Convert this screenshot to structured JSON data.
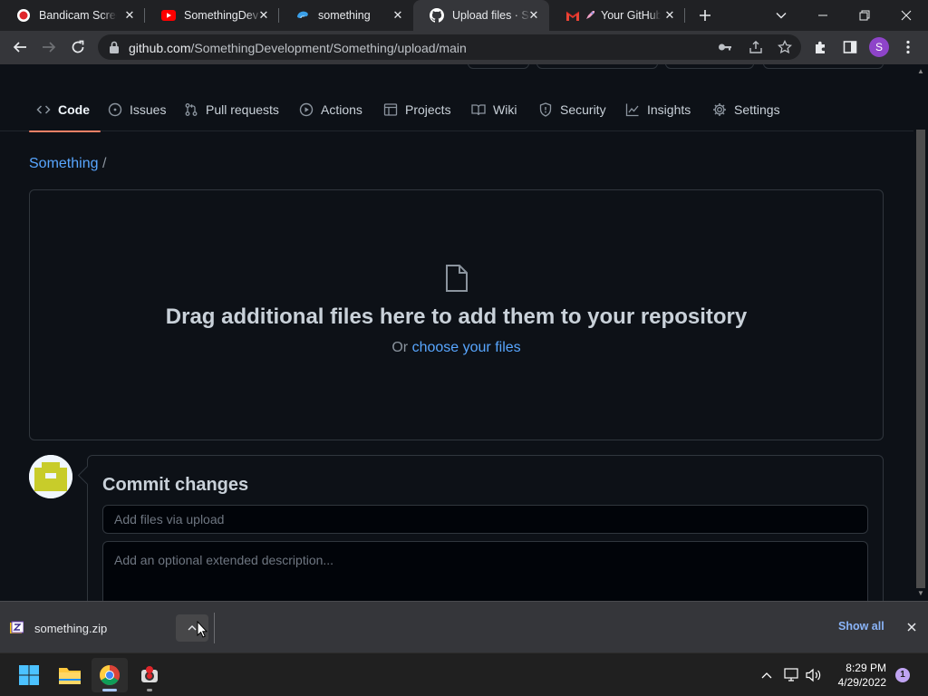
{
  "browser": {
    "tabs": [
      {
        "title": "Bandicam Screen Recorder",
        "icon": "bandicam-icon",
        "active": false
      },
      {
        "title": "SomethingDev",
        "icon": "youtube-icon",
        "active": false
      },
      {
        "title": "something",
        "icon": "edge-swirl-icon",
        "active": false
      },
      {
        "title": "Upload files · SomethingDevelopment/Something",
        "icon": "github-icon",
        "active": true
      },
      {
        "title": "Your GitHub launch code",
        "icon": "gmail-icon",
        "active": false
      }
    ],
    "url_domain": "github.com",
    "url_path": "/SomethingDevelopment/Something/upload/main",
    "profile_initial": "S"
  },
  "repo_nav": {
    "tabs": [
      {
        "label": "Code",
        "icon": "code-icon",
        "selected": true
      },
      {
        "label": "Issues",
        "icon": "issue-icon",
        "selected": false
      },
      {
        "label": "Pull requests",
        "icon": "pull-request-icon",
        "selected": false
      },
      {
        "label": "Actions",
        "icon": "play-icon",
        "selected": false
      },
      {
        "label": "Projects",
        "icon": "table-icon",
        "selected": false
      },
      {
        "label": "Wiki",
        "icon": "book-icon",
        "selected": false
      },
      {
        "label": "Security",
        "icon": "shield-icon",
        "selected": false
      },
      {
        "label": "Insights",
        "icon": "graph-icon",
        "selected": false
      },
      {
        "label": "Settings",
        "icon": "gear-icon",
        "selected": false
      }
    ]
  },
  "breadcrumb": {
    "repo": "Something",
    "separator": "/"
  },
  "dropzone": {
    "title": "Drag additional files here to add them to your repository",
    "or_text": "Or ",
    "link_text": "choose your files"
  },
  "commit": {
    "title": "Commit changes",
    "summary_placeholder": "Add files via upload",
    "description_placeholder": "Add an optional extended description..."
  },
  "download_bar": {
    "file_name": "something.zip",
    "show_all_label": "Show all"
  },
  "taskbar": {
    "time": "8:29 PM",
    "date": "4/29/2022",
    "notification_count": "1"
  },
  "colors": {
    "page_bg": "#0d1117",
    "link": "#58a6ff",
    "tab_underline": "#f78166",
    "border": "#30363d"
  }
}
